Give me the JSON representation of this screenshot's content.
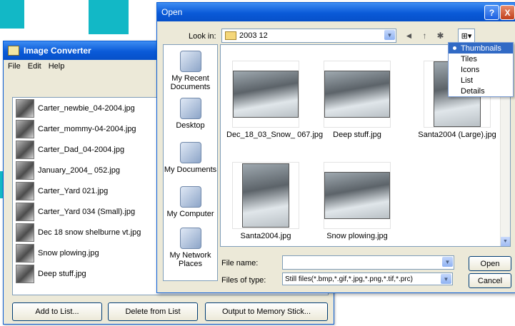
{
  "image_converter": {
    "title": "Image Converter",
    "menu": [
      "File",
      "Edit",
      "Help"
    ],
    "files": [
      "Carter_newbie_04-2004.jpg",
      "Carter_mommy-04-2004.jpg",
      "Carter_Dad_04-2004.jpg",
      "January_2004_ 052.jpg",
      "Carter_Yard 021.jpg",
      "Carter_Yard 034 (Small).jpg",
      "Dec 18 snow shelburne vt.jpg",
      "Snow plowing.jpg",
      "Deep stuff.jpg"
    ],
    "buttons": {
      "add": "Add to List...",
      "delete": "Delete from List",
      "output": "Output to Memory Stick..."
    }
  },
  "open_dialog": {
    "title": "Open",
    "help_btn": "?",
    "close_btn": "X",
    "look_in_label": "Look in:",
    "look_in_value": "2003 12",
    "places": [
      "My Recent Documents",
      "Desktop",
      "My Documents",
      "My Computer",
      "My Network Places"
    ],
    "thumbnails": [
      "Dec_18_03_Snow_ 067.jpg",
      "Deep stuff.jpg",
      "Santa2004 (Large).jpg",
      "Santa2004.jpg",
      "Snow plowing.jpg"
    ],
    "file_name_label": "File name:",
    "file_name_value": "",
    "files_of_type_label": "Files of type:",
    "files_of_type_value": "Still files(*.bmp,*.gif,*.jpg,*.png,*.tif,*.prc)",
    "open_button": "Open",
    "cancel_button": "Cancel",
    "view_menu": {
      "items": [
        "Thumbnails",
        "Tiles",
        "Icons",
        "List",
        "Details"
      ],
      "selected": "Thumbnails"
    }
  },
  "colors": {
    "titlebar": "#0a5ad8",
    "accent_teal": "#12b8c6",
    "selection": "#316ac5"
  }
}
